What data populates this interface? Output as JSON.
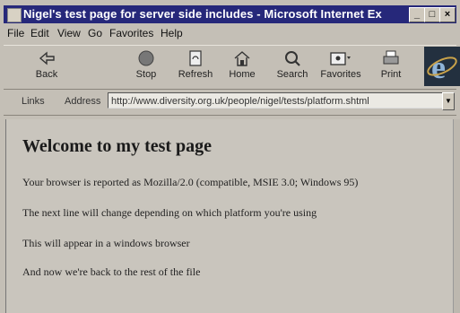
{
  "window": {
    "title": "Nigel's test page for server side includes - Microsoft Internet Explorer",
    "controls": {
      "minimize": "_",
      "maximize": "□",
      "close": "×"
    }
  },
  "menu": [
    "File",
    "Edit",
    "View",
    "Go",
    "Favorites",
    "Help"
  ],
  "toolbar": {
    "buttons": [
      {
        "label": "Back",
        "icon": "back-arrow-icon"
      },
      {
        "label": "Stop",
        "icon": "stop-icon"
      },
      {
        "label": "Refresh",
        "icon": "refresh-icon"
      },
      {
        "label": "Home",
        "icon": "home-icon"
      },
      {
        "label": "Search",
        "icon": "search-icon"
      },
      {
        "label": "Favorites",
        "icon": "favorites-icon"
      },
      {
        "label": "Print",
        "icon": "print-icon"
      }
    ],
    "logo": "ie-logo-icon"
  },
  "address_bar": {
    "links_label": "Links",
    "address_label": "Address",
    "url": "http://www.diversity.org.uk/people/nigel/tests/platform.shtml"
  },
  "page": {
    "heading": "Welcome to my test page",
    "paragraphs": [
      "Your browser is reported as Mozilla/2.0 (compatible, MSIE 3.0; Windows 95)",
      "The next line will change depending on which platform you're using",
      "This will appear in a windows browser",
      "And now we're back to the rest of the file"
    ]
  }
}
